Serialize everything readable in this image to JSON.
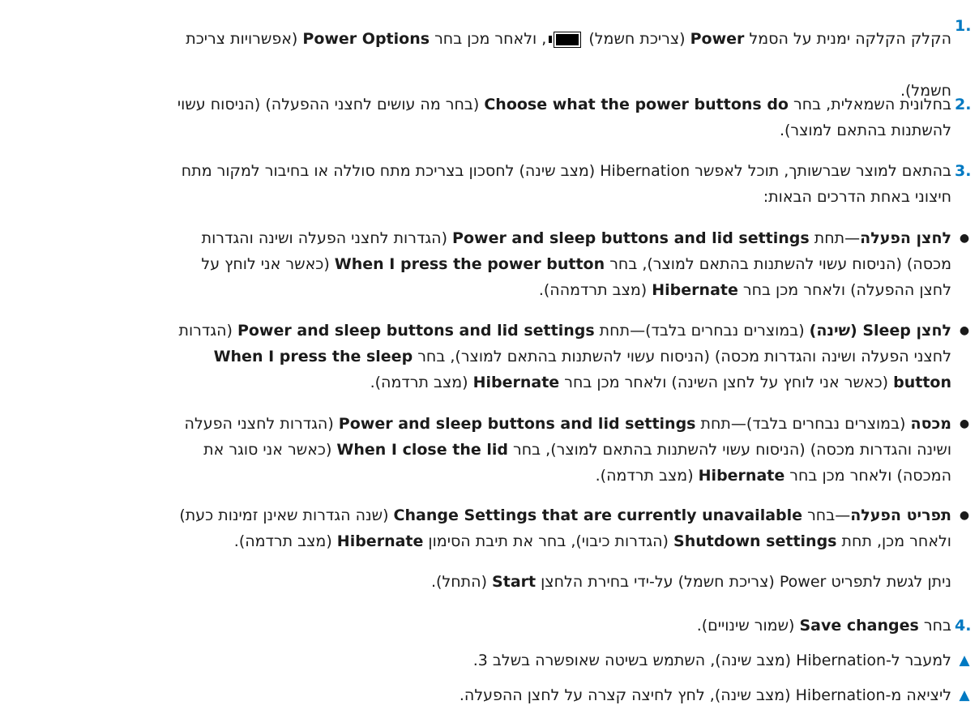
{
  "steps": [
    {
      "number": "1.",
      "lines": [
        [
          "הקלק הקלקה ימנית על הסמל ",
          {
            "b": "Power"
          },
          " (צריכת חשמל) ",
          {
            "icon": "battery"
          },
          ", ולאחר מכן בחר ",
          {
            "b": "Power Options"
          },
          " (אפשרויות צריכת"
        ],
        [
          "חשמל)."
        ]
      ]
    },
    {
      "number": "2.",
      "lines": [
        [
          "בחלונית השמאלית, בחר ",
          {
            "b": "Choose what the power buttons do"
          },
          " (בחר מה עושים לחצני ההפעלה) (הניסוח עשוי"
        ],
        [
          "להשתנות בהתאם למוצר)."
        ]
      ]
    },
    {
      "number": "3.",
      "lines": [
        [
          "בהתאם למוצר שברשותך, תוכל לאפשר Hibernation (מצב שינה) לחסכון בצריכת מתח סוללה או בחיבור למקור מתח"
        ],
        [
          "חיצוני באחת הדרכים הבאות:"
        ]
      ]
    }
  ],
  "bullets": [
    {
      "lines": [
        [
          {
            "b": "לחצן הפעלה"
          },
          "—תחת ",
          {
            "b": "Power and sleep buttons and lid settings"
          },
          " (הגדרות לחצני הפעלה ושינה והגדרות"
        ],
        [
          "מכסה) (הניסוח עשוי להשתנות בהתאם למוצר), בחר ",
          {
            "b": "When I press the power button"
          },
          " (כאשר אני לוחץ על"
        ],
        [
          "לחצן ההפעלה) ולאחר מכן בחר ",
          {
            "b": "Hibernate"
          },
          " (מצב תרדמהה)."
        ]
      ]
    },
    {
      "lines": [
        [
          {
            "b": "לחצן Sleep (שינה)"
          },
          " (במוצרים נבחרים בלבד)—תחת ",
          {
            "b": "Power and sleep buttons and lid settings"
          },
          " (הגדרות"
        ],
        [
          "לחצני הפעלה ושינה והגדרות מכסה) (הניסוח עשוי להשתנות בהתאם למוצר), בחר ",
          {
            "b": "When I press the sleep"
          }
        ],
        [
          {
            "b": "button"
          },
          " (כאשר אני לוחץ על לחצן השינה) ולאחר מכן בחר ",
          {
            "b": "Hibernate"
          },
          " (מצב תרדמה)."
        ]
      ]
    },
    {
      "lines": [
        [
          {
            "b": "מכסה"
          },
          " (במוצרים נבחרים בלבד)—תחת ",
          {
            "b": "Power and sleep buttons and lid settings"
          },
          " (הגדרות לחצני הפעלה"
        ],
        [
          "ושינה והגדרות מכסה) (הניסוח עשוי להשתנות בהתאם למוצר), בחר ",
          {
            "b": "When I close the lid"
          },
          " (כאשר אני סוגר את"
        ],
        [
          "המכסה) ולאחר מכן בחר ",
          {
            "b": "Hibernate"
          },
          " (מצב תרדמה)."
        ]
      ]
    },
    {
      "lines": [
        [
          {
            "b": "תפריט הפעלה"
          },
          "—בחר ",
          {
            "b": "Change Settings that are currently unavailable"
          },
          " (שנה הגדרות שאינן זמינות כעת)"
        ],
        [
          "ולאחר מכן, תחת ",
          {
            "b": "Shutdown settings"
          },
          " (הגדרות כיבוי), בחר את תיבת הסימון ",
          {
            "b": "Hibernate"
          },
          " (מצב תרדמה)."
        ]
      ]
    }
  ],
  "note": {
    "lines": [
      [
        "ניתן לגשת לתפריט Power (צריכת חשמל) על-ידי בחירת הלחצן ",
        {
          "b": "Start"
        },
        " (התחל)."
      ]
    ]
  },
  "step4": {
    "number": "4.",
    "lines": [
      [
        "בחר ",
        {
          "b": "Save changes"
        },
        " (שמור שינויים)."
      ]
    ]
  },
  "tips": [
    {
      "lines": [
        [
          "למעבר ל-Hibernation (מצב שינה), השתמש בשיטה שאופשרה בשלב 3."
        ]
      ]
    },
    {
      "lines": [
        [
          "ליציאה מ-Hibernation (מצב שינה), לחץ לחיצה קצרה על לחצן ההפעלה."
        ]
      ]
    }
  ],
  "colors": {
    "accent": "#0079c2",
    "text": "#1b1b1b"
  }
}
